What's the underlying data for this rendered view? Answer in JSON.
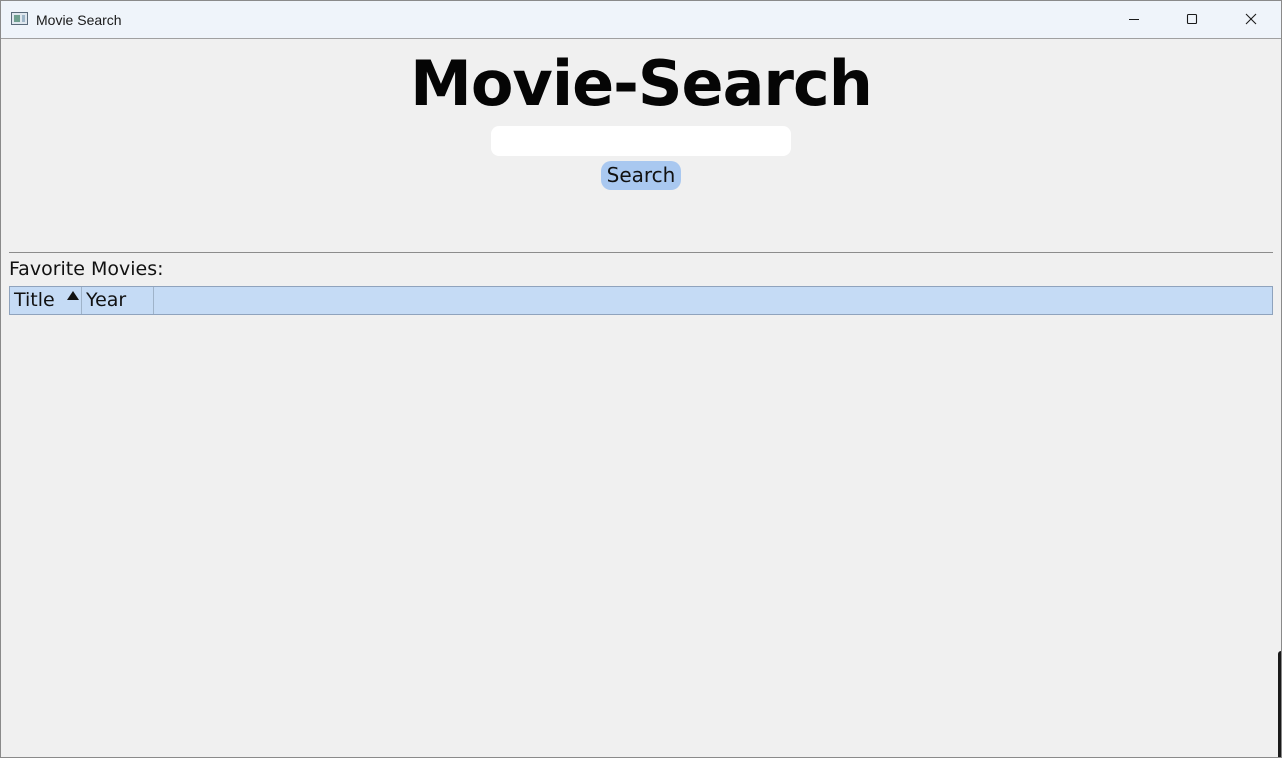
{
  "window": {
    "title": "Movie Search",
    "icon": "app-window-icon",
    "controls": {
      "minimize": "minimize-icon",
      "maximize": "maximize-icon",
      "close": "close-icon"
    }
  },
  "main": {
    "heading": "Movie-Search",
    "search": {
      "value": "",
      "placeholder": ""
    },
    "search_button_label": "Search"
  },
  "favorites": {
    "label": "Favorite Movies:",
    "columns": [
      {
        "label": "Title",
        "sort": "ascending"
      },
      {
        "label": "Year"
      }
    ],
    "rows": []
  },
  "colors": {
    "background": "#f0f0f0",
    "accent_button": "#a9c8f0",
    "table_header": "#c5dbf5"
  }
}
